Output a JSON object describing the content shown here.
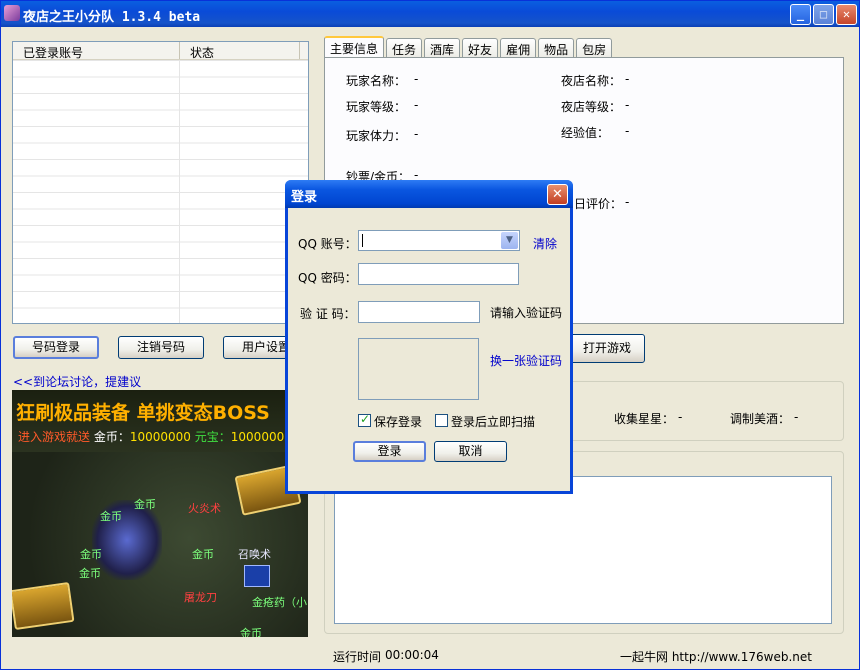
{
  "window": {
    "title": "夜店之王小分队 1.3.4 beta",
    "min": "_",
    "max": "□",
    "close": "✕"
  },
  "account_list": {
    "col_account": "已登录账号",
    "col_status": "状态"
  },
  "buttons": {
    "login": "号码登录",
    "logout": "注销号码",
    "user_settings": "用户设置",
    "open_game": "打开游戏"
  },
  "forum_link": "<<到论坛讨论，提建议",
  "ad": {
    "title": "狂刷极品装备  单挑变态BOSS",
    "sub_1": "进入游戏就送",
    "sub_2": "金币：",
    "sub_3": "10000000",
    "sub_4": "元宝：",
    "sub_5": "1000000",
    "labels": [
      "金币",
      "金币",
      "火炎术",
      "金币",
      "召唤术",
      "金币",
      "金币",
      "屠龙刀",
      "金疮药（小",
      "金币"
    ]
  },
  "tabs": [
    "主要信息",
    "任务",
    "酒库",
    "好友",
    "雇佣",
    "物品",
    "包房"
  ],
  "main_info": {
    "player_name": "玩家名称：",
    "player_name_val": "-",
    "club_name": "夜店名称：",
    "club_name_val": "-",
    "player_level": "玩家等级：",
    "player_level_val": "-",
    "club_level": "夜店等级：",
    "club_level_val": "-",
    "stamina": "玩家体力：",
    "stamina_val": "-",
    "exp": "经验值：",
    "exp_val": "-",
    "money": "钞票/金币：",
    "money_val": "-",
    "rating_partial": "日评价：",
    "rating_val": "-"
  },
  "stats": {
    "stars": "收集星星：",
    "stars_val": "-",
    "wine": "调制美酒：",
    "wine_val": "-"
  },
  "status": {
    "runtime_label": "运行时间",
    "runtime_val": "00:00:04",
    "site": "一起牛网 http://www.176web.net"
  },
  "dialog": {
    "title": "登录",
    "close": "✕",
    "qq_label": "QQ 账号：",
    "clear": "清除",
    "pwd_label": "QQ 密码：",
    "captcha_label": "验 证 码：",
    "captcha_hint": "请输入验证码",
    "change_captcha": "换一张验证码",
    "save_login": "保存登录",
    "scan_after": "登录后立即扫描",
    "ok": "登录",
    "cancel": "取消",
    "save_login_checked": true,
    "scan_after_checked": false
  }
}
